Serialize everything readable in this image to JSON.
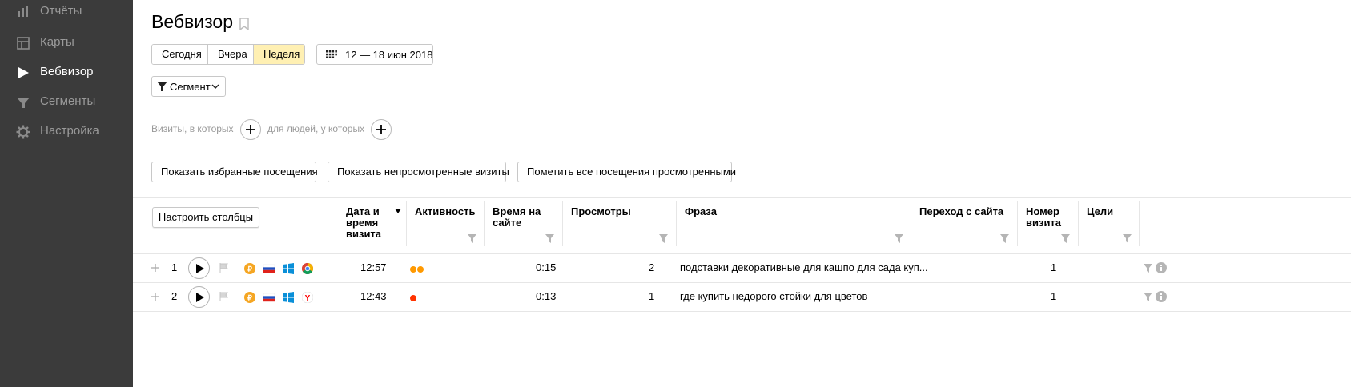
{
  "sidebar": {
    "items": [
      {
        "label": "Отчёты",
        "icon": "bar-chart-icon"
      },
      {
        "label": "Карты",
        "icon": "map-icon"
      },
      {
        "label": "Вебвизор",
        "icon": "play-icon",
        "active": true
      },
      {
        "label": "Сегменты",
        "icon": "filter-icon"
      },
      {
        "label": "Настройка",
        "icon": "gear-icon"
      }
    ]
  },
  "header": {
    "title": "Вебвизор"
  },
  "period": {
    "options": [
      "Сегодня",
      "Вчера",
      "Неделя"
    ],
    "selected": "Неделя",
    "date_range": "12 — 18 июн 2018"
  },
  "segment_button": "Сегмент",
  "conditions": {
    "visits_label": "Визиты, в которых",
    "people_label": "для людей, у которых"
  },
  "actions": {
    "show_favorites": "Показать избранные посещения",
    "show_unviewed": "Показать непросмотренные визиты",
    "mark_all_viewed": "Пометить все посещения просмотренными"
  },
  "table": {
    "configure_columns": "Настроить столбцы",
    "columns": {
      "datetime": "Дата и время визита",
      "activity": "Активность",
      "time_on_site": "Время на сайте",
      "pageviews": "Просмотры",
      "phrase": "Фраза",
      "referrer": "Переход с сайта",
      "visit_number": "Номер визита",
      "goals": "Цели"
    },
    "rows": [
      {
        "index": "1",
        "time": "12:57",
        "activity_dots": 2,
        "duration": "0:15",
        "pageviews": "2",
        "phrase": "подставки декоративные для кашпо для сада куп...",
        "referrer": "",
        "visit_number": "1",
        "browser": "chrome-icon"
      },
      {
        "index": "2",
        "time": "12:43",
        "activity_dots": 1,
        "duration": "0:13",
        "pageviews": "1",
        "phrase": "где купить недорого стойки для цветов",
        "referrer": "",
        "visit_number": "1",
        "browser": "yandex-browser-icon"
      }
    ]
  },
  "colors": {
    "sidebar_bg": "#3b3b3b",
    "selected_period": "#fff0b3",
    "activity_orange": "#ff9900",
    "activity_red": "#ff3300"
  }
}
